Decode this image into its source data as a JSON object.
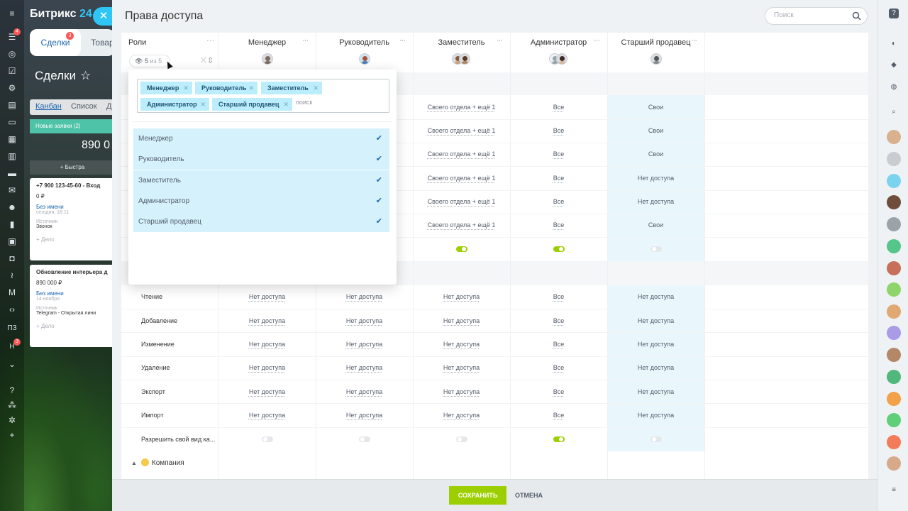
{
  "portal": {
    "logo": "Битрикс",
    "logo_suffix": "24",
    "nav_badges": {
      "first": "4",
      "h": "3"
    },
    "nav_text_items": [
      "ПЗ",
      "Н"
    ],
    "tabs": [
      {
        "label": "Сделки",
        "badge": "3"
      },
      {
        "label": "Товар"
      }
    ],
    "page_title": "Сделки",
    "views": [
      "Канбан",
      "Список",
      "Д"
    ],
    "stage": {
      "label": "Новые заявки",
      "count": "(2)",
      "sum": "890 0"
    },
    "quick_add": "+ Быстра",
    "cards": [
      {
        "title": "+7 900 123-45-60 - Вход",
        "sum": "0 ₽",
        "client": "Без имени",
        "date": "сегодня, 16:11",
        "source_label": "Источник",
        "source": "Звонок",
        "action": "+ Дело"
      },
      {
        "title": "Обновление интерьера д",
        "sum": "890 000 ₽",
        "client": "Без имени",
        "date": "14 ноября",
        "source_label": "Источник",
        "source": "Telegram - Открытая лини",
        "action": "+ Дело"
      }
    ]
  },
  "panel": {
    "title": "Права доступа",
    "search_placeholder": "Поиск",
    "roles_label": "Роли",
    "roles_filter": {
      "count": "5",
      "of": "из 5"
    },
    "columns": [
      "Менеджер",
      "Руководитель",
      "Заместитель",
      "Администратор",
      "Старший продавец"
    ],
    "dots": "···",
    "top_rows": [
      [
        "Своего отдела + ещё 1",
        "Все",
        "Свои"
      ],
      [
        "Своего отдела + ещё 1",
        "Все",
        "Свои"
      ],
      [
        "Своего отдела + ещё 1",
        "Все",
        "Свои"
      ],
      [
        "Своего отдела + ещё 1",
        "Все",
        "Нет доступа"
      ],
      [
        "Своего отдела + ещё 1",
        "Все",
        "Нет доступа"
      ],
      [
        "Своего отдела + ещё 1",
        "Все",
        "Свои"
      ]
    ],
    "top_toggles": [
      true,
      true,
      false
    ],
    "section_rows": [
      {
        "label": "Чтение",
        "values": [
          "Нет доступа",
          "Нет доступа",
          "Нет доступа",
          "Все",
          "Нет доступа"
        ]
      },
      {
        "label": "Добавление",
        "values": [
          "Нет доступа",
          "Нет доступа",
          "Нет доступа",
          "Все",
          "Нет доступа"
        ]
      },
      {
        "label": "Изменение",
        "values": [
          "Нет доступа",
          "Нет доступа",
          "Нет доступа",
          "Все",
          "Нет доступа"
        ]
      },
      {
        "label": "Удаление",
        "values": [
          "Нет доступа",
          "Нет доступа",
          "Нет доступа",
          "Все",
          "Нет доступа"
        ]
      },
      {
        "label": "Экспорт",
        "values": [
          "Нет доступа",
          "Нет доступа",
          "Нет доступа",
          "Все",
          "Нет доступа"
        ]
      },
      {
        "label": "Импорт",
        "values": [
          "Нет доступа",
          "Нет доступа",
          "Нет доступа",
          "Все",
          "Нет доступа"
        ]
      }
    ],
    "toggle_row": {
      "label": "Разрешить свой вид ка...",
      "states": [
        false,
        false,
        false,
        true,
        false
      ]
    },
    "company_label": "Компания"
  },
  "popup": {
    "tags": [
      "Менеджер",
      "Руководитель",
      "Заместитель",
      "Администратор",
      "Старший продавец"
    ],
    "tag_search_placeholder": "поиск",
    "options": [
      {
        "label": "Менеджер",
        "checked": true
      },
      {
        "label": "Руководитель",
        "checked": true
      },
      {
        "label": "Заместитель",
        "checked": true
      },
      {
        "label": "Администратор",
        "checked": true
      },
      {
        "label": "Старший продавец",
        "checked": true
      }
    ]
  },
  "footer": {
    "save_label": "СОХРАНИТЬ",
    "cancel_label": "ОТМЕНА"
  },
  "colors": {
    "accent": "#2fc6f6",
    "save": "#9dcf00",
    "tag_bg": "#bcedfc",
    "option_bg": "#d4f1fc"
  },
  "icons": {
    "close": "close-icon",
    "search": "search-icon",
    "check": "check-icon",
    "collapse": "collapse-icon",
    "star": "star-icon"
  }
}
